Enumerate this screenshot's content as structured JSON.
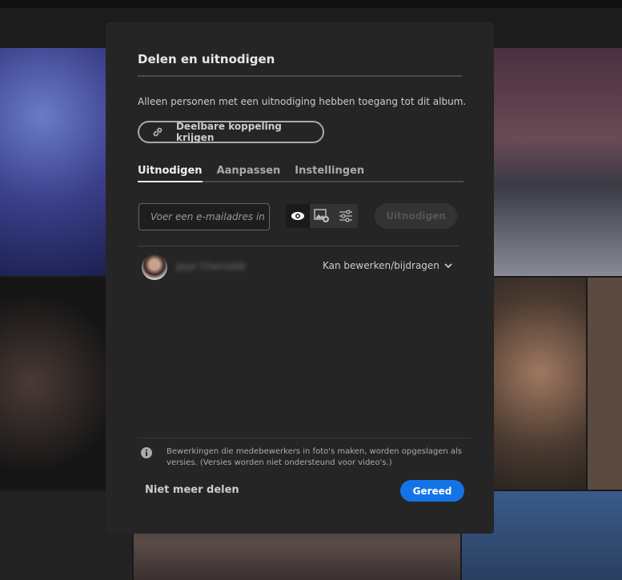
{
  "dialog": {
    "title": "Delen en uitnodigen",
    "description": "Alleen personen met een uitnodiging hebben toegang tot dit album.",
    "link_button": "Deelbare koppeling krijgen",
    "tabs": [
      {
        "label": "Uitnodigen",
        "active": true
      },
      {
        "label": "Aanpassen",
        "active": false
      },
      {
        "label": "Instellingen",
        "active": false
      }
    ],
    "email_placeholder": "Voer een e-mailadres in",
    "invite_button": "Uitnodigen",
    "permission_icons": [
      "eye-icon",
      "image-add-icon",
      "sliders-icon"
    ],
    "collaborator": {
      "name": "Jaye Chernoldi",
      "permission": "Kan bewerken/bijdragen"
    },
    "note": "Bewerkingen die medebewerkers in foto's maken, worden opgeslagen als versies. (Versies worden niet ondersteund voor video's.)",
    "stop_sharing": "Niet meer delen",
    "done_button": "Gereed",
    "accent": "#1473e6"
  }
}
